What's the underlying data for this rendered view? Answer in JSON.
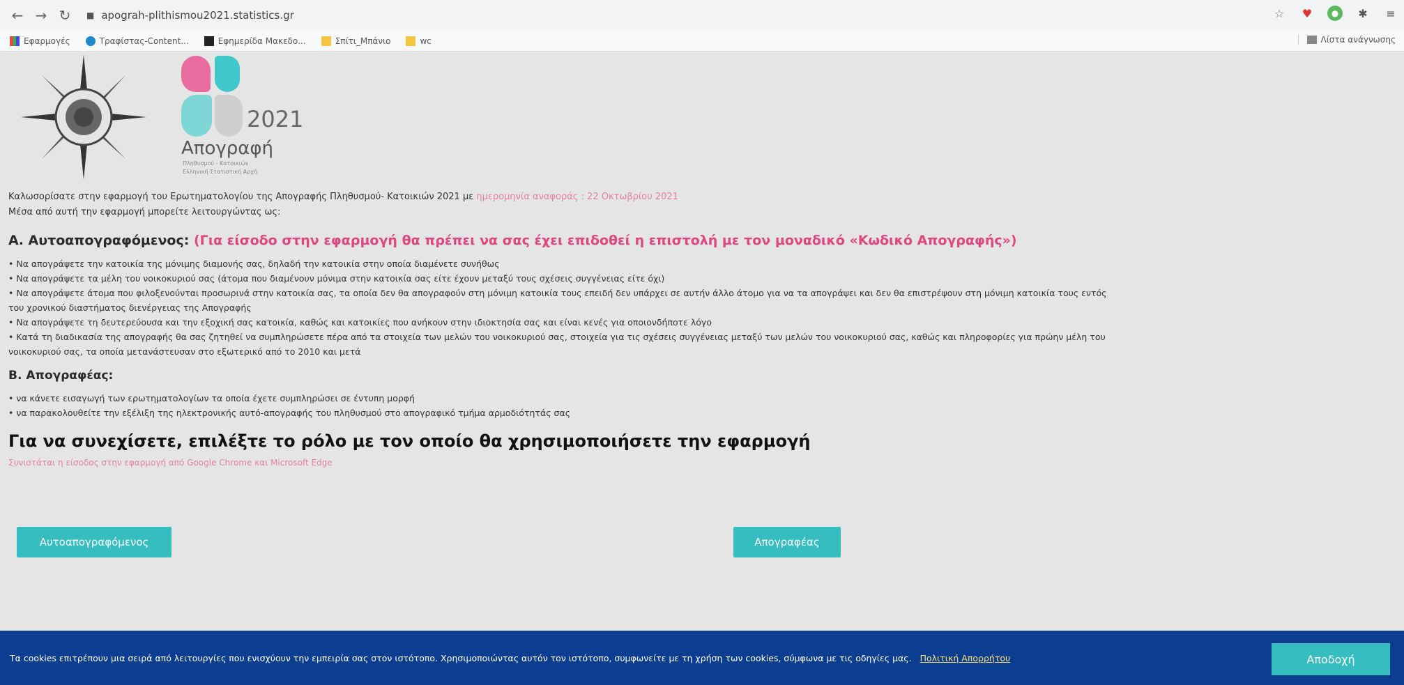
{
  "browser": {
    "url": "apograh-plithismou2021.statistics.gr",
    "bookmarks": [
      {
        "label": "Εφαρμογές"
      },
      {
        "label": "Τραφίστας-Content..."
      },
      {
        "label": "Εφημερίδα Μακεδο..."
      },
      {
        "label": "Σπίτι_Μπάνιο"
      },
      {
        "label": "wc"
      }
    ],
    "reading_list": "Λίστα ανάγνωσης"
  },
  "logo": {
    "year": "2021",
    "title": "Απογραφή",
    "sub1": "Πληθυσμού - Κατοικιών",
    "sub2": "Ελληνική Στατιστική Αρχή"
  },
  "intro": {
    "line1": "Καλωσορίσατε στην εφαρμογή του Ερωτηματολογίου της Απογραφής Πληθυσμού- Κατοικιών 2021 με",
    "ref_date": "ημερομηνία αναφοράς : 22 Οκτωβρίου 2021",
    "line2": "Μέσα από αυτή την εφαρμογή μπορείτε λειτουργώντας ως:"
  },
  "section_a": {
    "title": "Α. Αυτοαπογραφόμενος:",
    "note": "(Για είσοδο στην εφαρμογή θα πρέπει να σας έχει επιδοθεί η επιστολή με τον μοναδικό «Κωδικό Απογραφής»)",
    "bullets": [
      "• Να απογράψετε την κατοικία της μόνιμης διαμονής σας, δηλαδή την κατοικία στην οποία διαμένετε συνήθως",
      "• Να απογράψετε τα μέλη του νοικοκυριού σας (άτομα που διαμένουν μόνιμα στην κατοικία σας είτε έχουν μεταξύ τους σχέσεις συγγένειας είτε όχι)",
      "• Να απογράψετε άτομα που φιλοξενούνται προσωρινά στην κατοικία σας, τα οποία δεν θα απογραφούν στη μόνιμη κατοικία τους επειδή δεν υπάρχει σε αυτήν άλλο άτομο για να τα απογράψει και δεν θα επιστρέψουν στη μόνιμη κατοικία τους εντός",
      "του χρονικού διαστήματος διενέργειας της Απογραφής",
      "• Να απογράψετε τη δευτερεύουσα και την εξοχική σας κατοικία, καθώς και κατοικίες που ανήκουν στην ιδιοκτησία σας και είναι κενές για οποιονδήποτε λόγο",
      "• Κατά τη διαδικασία της απογραφής θα σας ζητηθεί να συμπληρώσετε πέρα από τα στοιχεία των μελών του νοικοκυριού σας, στοιχεία για τις σχέσεις συγγένειας μεταξύ των μελών του νοικοκυριού σας, καθώς και πληροφορίες για πρώην μέλη του",
      "νοικοκυριού σας, τα οποία μετανάστευσαν στο εξωτερικό από το 2010 και μετά"
    ]
  },
  "section_b": {
    "title": "Β. Απογραφέας:",
    "bullets": [
      "• να κάνετε εισαγωγή των ερωτηματολογίων τα οποία έχετε συμπληρώσει σε έντυπη μορφή",
      "• να παρακολουθείτε την εξέλιξη της ηλεκτρονικής αυτό-απογραφής του πληθυσμού στο απογραφικό τμήμα αρμοδιότητάς σας"
    ]
  },
  "choose_role": "Για να συνεχίσετε, επιλέξτε το ρόλο με τον οποίο θα χρησιμοποιήσετε την εφαρμογή",
  "browser_hint": "Συνιστάται η είσοδος στην εφαρμογή από Google Chrome και Microsoft Edge",
  "buttons": {
    "self": "Αυτοαπογραφόμενος",
    "enumerator": "Απογραφέας"
  },
  "cookie": {
    "text": "Τα cookies επιτρέπουν μια σειρά από λειτουργίες που ενισχύουν την εμπειρία σας στον ιστότοπο. Χρησιμοποιώντας αυτόν τον ιστότοπο, συμφωνείτε με τη χρήση των cookies, σύμφωνα με τις οδηγίες μας.",
    "link": "Πολιτική Απορρήτου",
    "accept": "Αποδοχή"
  },
  "colors": {
    "accent": "#35bdc0",
    "pink": "#e0477f",
    "banner": "#0b3d91"
  }
}
